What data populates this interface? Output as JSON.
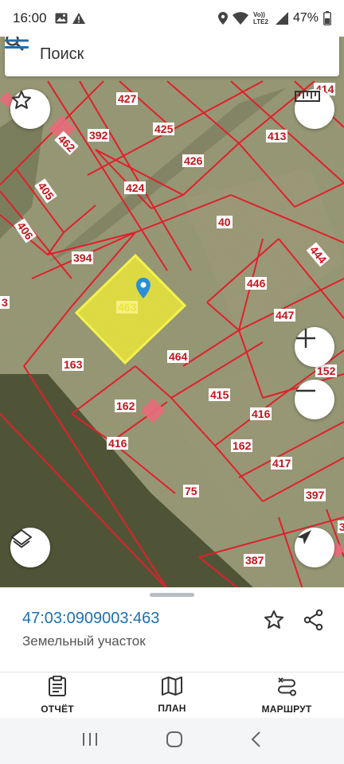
{
  "status_bar": {
    "time": "16:00",
    "network_label": "Vo)) LTE2",
    "battery_percent": "47%"
  },
  "search": {
    "placeholder": "Поиск"
  },
  "map": {
    "selected_parcel_label": "463",
    "parcel_labels": [
      "427",
      "392",
      "462",
      "425",
      "413",
      "414",
      "405",
      "424",
      "426",
      "406",
      "40",
      "394",
      "444",
      "446",
      "3",
      "463",
      "447",
      "163",
      "464",
      "152",
      "415",
      "162",
      "416",
      "162",
      "416",
      "417",
      "75",
      "397",
      "3",
      "387"
    ],
    "colors": {
      "boundary": "#e0202a",
      "selected_fill": "#e9e53a",
      "selected_stroke": "#f4f24a",
      "label_text": "#c4151c",
      "pin": "#2a8fd6"
    }
  },
  "sheet": {
    "parcel_id": "47:03:0909003:463",
    "parcel_type": "Земельный участок"
  },
  "bottom_nav": {
    "items": [
      {
        "label": "ОТЧЁТ",
        "icon": "clipboard-icon"
      },
      {
        "label": "ПЛАН",
        "icon": "map-icon"
      },
      {
        "label": "МАРШРУТ",
        "icon": "route-icon"
      }
    ]
  }
}
